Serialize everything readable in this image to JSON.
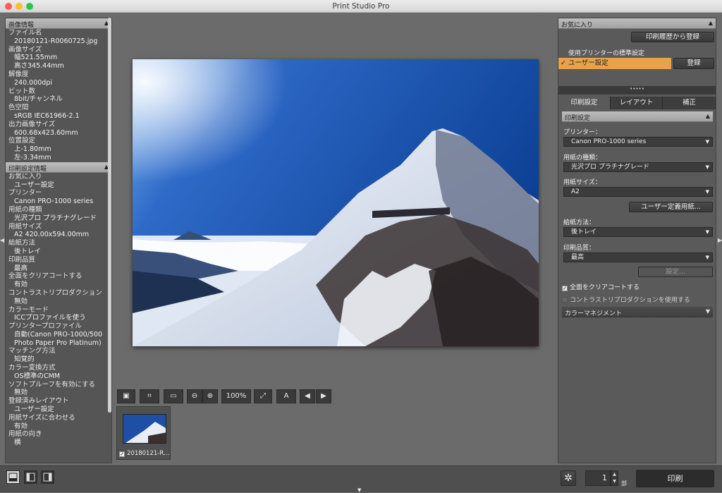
{
  "window": {
    "title": "Print Studio Pro"
  },
  "left_panel": {
    "image_info": {
      "header": "画像情報",
      "lines": [
        {
          "t": "ファイル名",
          "v": false
        },
        {
          "t": "20180121-R0060725.jpg",
          "v": true
        },
        {
          "t": "画像サイズ",
          "v": false
        },
        {
          "t": "幅521.55mm",
          "v": true
        },
        {
          "t": "高さ345.44mm",
          "v": true
        },
        {
          "t": "解像度",
          "v": false
        },
        {
          "t": "240.000dpi",
          "v": true
        },
        {
          "t": "ビット数",
          "v": false
        },
        {
          "t": "8bit/チャンネル",
          "v": true
        },
        {
          "t": "色空間",
          "v": false
        },
        {
          "t": "sRGB IEC61966-2.1",
          "v": true
        },
        {
          "t": "出力画像サイズ",
          "v": false
        },
        {
          "t": "600.68x423.60mm",
          "v": true
        },
        {
          "t": "位置設定",
          "v": false
        },
        {
          "t": "上-1.80mm",
          "v": true
        },
        {
          "t": "左-3.34mm",
          "v": true
        }
      ]
    },
    "print_info": {
      "header": "印刷設定情報",
      "lines": [
        {
          "t": "お気に入り",
          "v": false
        },
        {
          "t": "ユーザー設定",
          "v": true
        },
        {
          "t": "プリンター",
          "v": false
        },
        {
          "t": "Canon PRO-1000 series",
          "v": true
        },
        {
          "t": "用紙の種類",
          "v": false
        },
        {
          "t": "光沢プロ プラチナグレード",
          "v": true
        },
        {
          "t": "用紙サイズ",
          "v": false
        },
        {
          "t": "A2 420.00x594.00mm",
          "v": true
        },
        {
          "t": "給紙方法",
          "v": false
        },
        {
          "t": "後トレイ",
          "v": true
        },
        {
          "t": "印刷品質",
          "v": false
        },
        {
          "t": "最高",
          "v": true
        },
        {
          "t": "全面をクリアコートする",
          "v": false
        },
        {
          "t": "有効",
          "v": true
        },
        {
          "t": "コントラストリプロダクション",
          "v": false
        },
        {
          "t": "無効",
          "v": true
        },
        {
          "t": "カラーモード",
          "v": false
        },
        {
          "t": "ICCプロファイルを使う",
          "v": true
        },
        {
          "t": "プリンタープロファイル",
          "v": false
        },
        {
          "t": "自動(Canon PRO-1000/500",
          "v": true
        },
        {
          "t": "Photo Paper Pro Platinum)",
          "v": true
        },
        {
          "t": "マッチング方法",
          "v": false
        },
        {
          "t": "知覚的",
          "v": true
        },
        {
          "t": "カラー変換方式",
          "v": false
        },
        {
          "t": "OS標準のCMM",
          "v": true
        },
        {
          "t": "ソフトプルーフを有効にする",
          "v": false
        },
        {
          "t": "無効",
          "v": true
        },
        {
          "t": "登録済みレイアウト",
          "v": false
        },
        {
          "t": "ユーザー設定",
          "v": true
        },
        {
          "t": "用紙サイズに合わせる",
          "v": false
        },
        {
          "t": "有効",
          "v": true
        },
        {
          "t": "用紙の向き",
          "v": false
        },
        {
          "t": "横",
          "v": true
        }
      ]
    }
  },
  "toolbar": {
    "zoom": "100%"
  },
  "thumbnail": {
    "caption": "20180121-R..."
  },
  "right_panel": {
    "favorites_header": "お気に入り",
    "history_button": "印刷履歴から登録",
    "default_printer_label": "使用プリンターの標準設定",
    "user_setting": "ユーザー設定",
    "register_button": "登録",
    "tabs": [
      "印刷設定",
      "レイアウト",
      "補正"
    ],
    "print_settings_header": "印刷設定",
    "printer_label": "プリンター：",
    "printer_value": "Canon PRO-1000 series",
    "media_label": "用紙の種類：",
    "media_value": "光沢プロ プラチナグレード",
    "size_label": "用紙サイズ：",
    "size_value": "A2",
    "custom_size_button": "ユーザー定義用紙...",
    "source_label": "給紙方法：",
    "source_value": "後トレイ",
    "quality_label": "印刷品質：",
    "quality_value": "最高",
    "settings_button": "設定...",
    "clear_coat": "全面をクリアコートする",
    "contrast": "コントラストリプロダクションを使用する",
    "color_mgmt": "カラーマネジメント"
  },
  "bottom": {
    "copies": "1",
    "copies_unit": "部",
    "print_button": "印刷"
  },
  "colors": {
    "accent": "#e8a24a"
  }
}
